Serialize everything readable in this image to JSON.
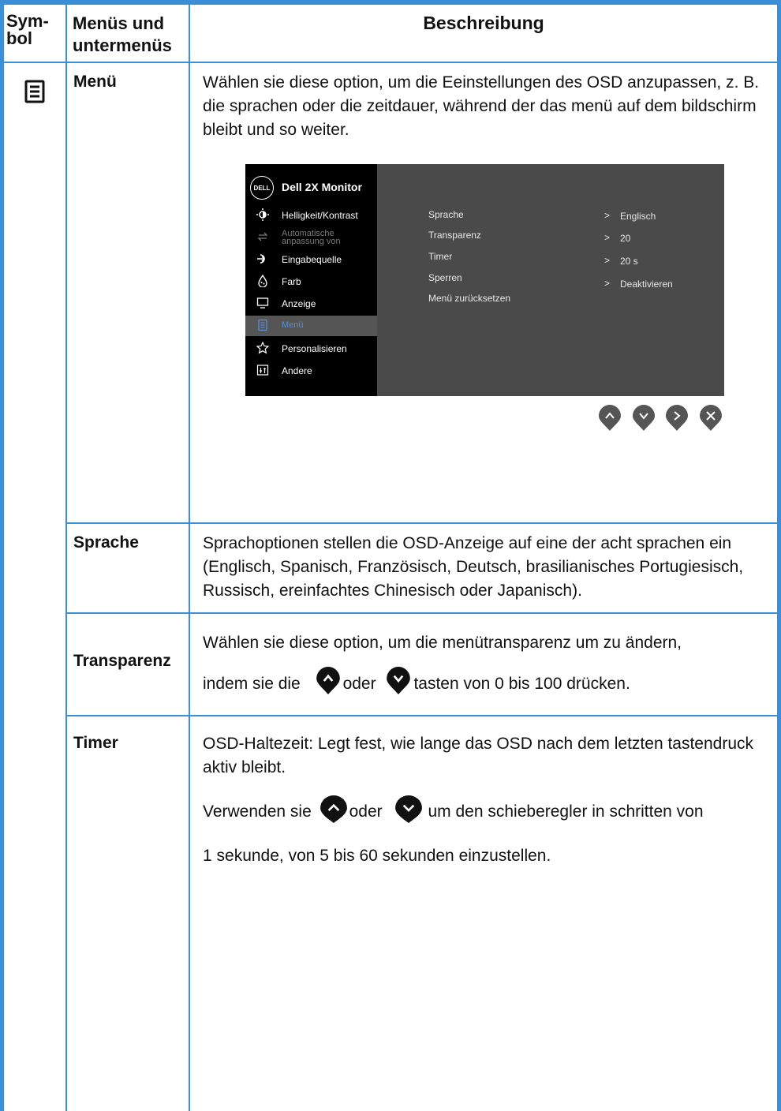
{
  "header": {
    "symbol": "Sym-\nbol",
    "menus": "Menüs und\nuntermenüs",
    "description": "Beschreibung"
  },
  "rows": {
    "menu": {
      "name": "Menü",
      "desc": "Wählen sie diese option, um die Eeinstellungen des OSD anzupassen, z. B. die sprachen oder die zeitdauer, während der das menü auf dem bildschirm bleibt und so weiter."
    },
    "sprache": {
      "name": "Sprache",
      "desc": "Sprachoptionen stellen die OSD-Anzeige auf eine der acht sprachen ein (Englisch, Spanisch, Französisch, Deutsch, brasilianisches Portugiesisch, Russisch, ereinfachtes Chinesisch oder Japanisch)."
    },
    "transparenz": {
      "name": "Transparenz",
      "line1": "Wählen sie diese option, um die menütransparenz um zu ändern,",
      "line2_a": "indem sie die",
      "line2_b": "oder",
      "line2_c": "tasten von 0 bis 100 drücken."
    },
    "timer": {
      "name": "Timer",
      "p1": "OSD-Haltezeit: Legt fest, wie lange das OSD nach dem letzten tastendruck aktiv bleibt.",
      "p2_a": "Verwenden sie",
      "p2_b": "oder",
      "p2_c": "um den schieberegler in schritten von",
      "p3": "1 sekunde, von 5 bis 60 sekunden einzustellen."
    }
  },
  "osd": {
    "logo": "DELL",
    "title": "Dell 2X Monitor",
    "menu": [
      {
        "label": "Helligkeit/Kontrast",
        "icon": "brightness-icon"
      },
      {
        "label": "Automatische\nanpassung von",
        "icon": "auto-adjust-icon"
      },
      {
        "label": "Eingabequelle",
        "icon": "input-source-icon"
      },
      {
        "label": "Farb",
        "icon": "color-icon"
      },
      {
        "label": "Anzeige",
        "icon": "display-icon"
      },
      {
        "label": "Menü",
        "icon": "menu-icon"
      },
      {
        "label": "Personalisieren",
        "icon": "star-icon"
      },
      {
        "label": "Andere",
        "icon": "other-icon"
      }
    ],
    "options": [
      {
        "label": "Sprache",
        "value": "Englisch"
      },
      {
        "label": "Transparenz",
        "value": "20"
      },
      {
        "label": "Timer",
        "value": "20 s"
      },
      {
        "label": "Sperren",
        "value": "Deaktivieren"
      },
      {
        "label": "Menü zurücksetzen",
        "value": ""
      }
    ],
    "arrow": ">"
  },
  "colors": {
    "border": "#3a8fd6",
    "osd_bg": "#4a4a4a",
    "osd_selected_text": "#5b8fd6"
  }
}
